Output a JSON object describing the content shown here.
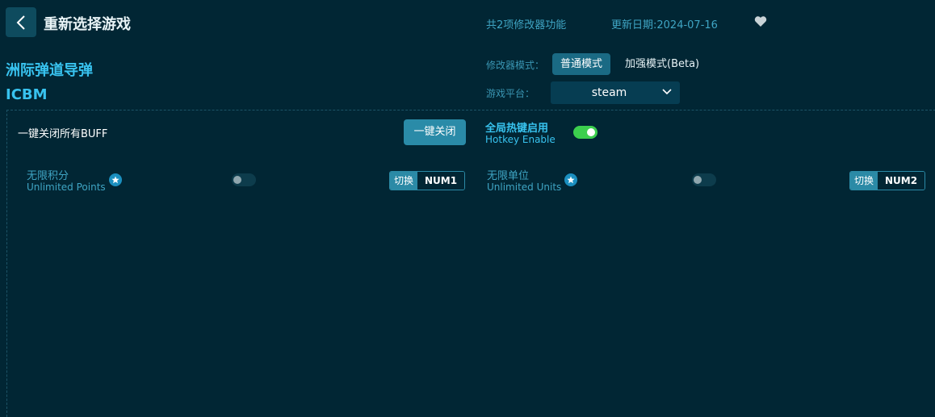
{
  "header": {
    "title": "重新选择游戏",
    "feature_count": "共2项修改器功能",
    "update_date": "更新日期:2024-07-16"
  },
  "game": {
    "name_cn": "洲际弹道导弹",
    "name_en": "ICBM"
  },
  "mode": {
    "label": "修改器模式：",
    "options": [
      "普通模式",
      "加强模式(Beta)"
    ],
    "selected": "普通模式"
  },
  "platform": {
    "label": "游戏平台：",
    "selected": "steam"
  },
  "controls": {
    "all_off_label": "一键关闭所有BUFF",
    "all_off_button": "一键关闭",
    "hotkey_title": "全局热键启用",
    "hotkey_subtitle": "Hotkey Enable"
  },
  "features": [
    {
      "name_cn": "无限积分",
      "name_en": "Unlimited Points",
      "switch_label": "切换",
      "key": "NUM1"
    },
    {
      "name_cn": "无限单位",
      "name_en": "Unlimited Units",
      "switch_label": "切换",
      "key": "NUM2"
    }
  ],
  "icons": {
    "back": "chevron-left-icon",
    "favorite": "heart-icon",
    "dropdown": "chevron-down-icon",
    "feature_badge": "star-icon"
  },
  "colors": {
    "background": "#012634",
    "accent": "#38c3ef",
    "toggle_on": "#3ccf4e",
    "button": "#2a8ba8"
  }
}
